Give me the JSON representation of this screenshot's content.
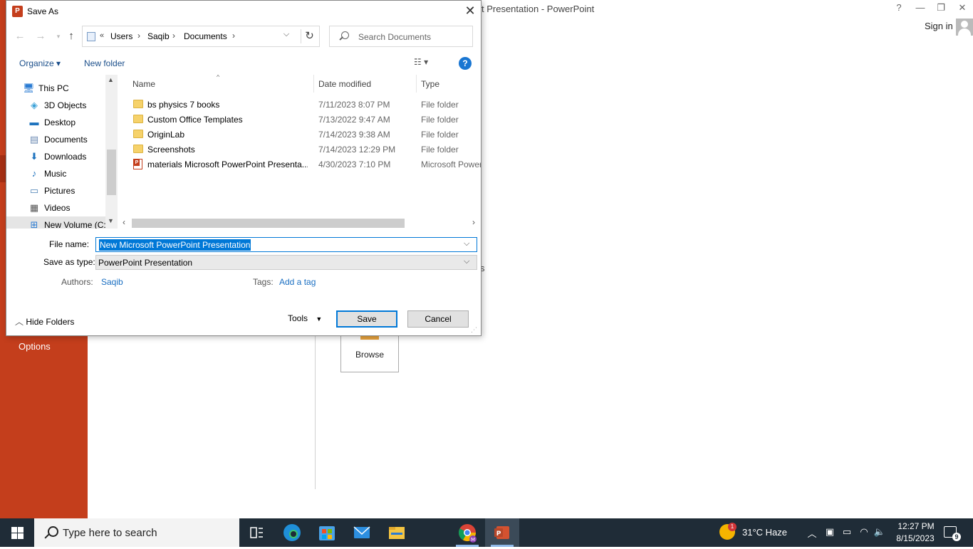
{
  "powerpoint": {
    "title_fragment": "t Presentation - PowerPoint",
    "signin": "Sign in",
    "options": "Options",
    "browse": "Browse",
    "partial_text": "s",
    "help_glyph": "?",
    "min_glyph": "—",
    "restore_glyph": "❐",
    "close_glyph": "✕"
  },
  "dialog": {
    "title": "Save As",
    "app_icon_letter": "P",
    "address": {
      "chevron": "«",
      "crumbs": [
        "Users",
        "Saqib",
        "Documents"
      ],
      "separator": "›"
    },
    "search_placeholder": "Search Documents",
    "toolbar": {
      "organize": "Organize ▾",
      "new_folder": "New folder",
      "help": "?"
    },
    "nav": [
      {
        "label": "This PC",
        "icon": "computer-icon"
      },
      {
        "label": "3D Objects",
        "icon": "cube-icon"
      },
      {
        "label": "Desktop",
        "icon": "desktop-icon"
      },
      {
        "label": "Documents",
        "icon": "document-icon"
      },
      {
        "label": "Downloads",
        "icon": "download-icon"
      },
      {
        "label": "Music",
        "icon": "music-icon"
      },
      {
        "label": "Pictures",
        "icon": "picture-icon"
      },
      {
        "label": "Videos",
        "icon": "video-icon"
      },
      {
        "label": "New Volume (C:",
        "icon": "drive-icon"
      }
    ],
    "columns": {
      "name": "Name",
      "date": "Date modified",
      "type": "Type"
    },
    "files": [
      {
        "name": "bs physics 7 books",
        "date": "7/11/2023 8:07 PM",
        "type": "File folder",
        "kind": "folder"
      },
      {
        "name": "Custom Office Templates",
        "date": "7/13/2022 9:47 AM",
        "type": "File folder",
        "kind": "folder"
      },
      {
        "name": "OriginLab",
        "date": "7/14/2023 9:38 AM",
        "type": "File folder",
        "kind": "folder"
      },
      {
        "name": "Screenshots",
        "date": "7/14/2023 12:29 PM",
        "type": "File folder",
        "kind": "folder"
      },
      {
        "name": "materials Microsoft PowerPoint Presenta...",
        "date": "4/30/2023 7:10 PM",
        "type": "Microsoft Power",
        "kind": "ppt"
      }
    ],
    "form": {
      "filename_label": "File name:",
      "filename_value": "New Microsoft PowerPoint Presentation",
      "savetype_label": "Save as type:",
      "savetype_value": "PowerPoint Presentation",
      "authors_label": "Authors:",
      "authors_value": "Saqib",
      "tags_label": "Tags:",
      "tags_value": "Add a tag"
    },
    "footer": {
      "hide_folders": "Hide Folders",
      "tools": "Tools",
      "save": "Save",
      "cancel": "Cancel"
    }
  },
  "taskbar": {
    "search_text": "Type here to search",
    "weather": "31°C  Haze",
    "weather_badge": "1",
    "time": "12:27 PM",
    "date": "8/15/2023",
    "notifications": "9"
  }
}
